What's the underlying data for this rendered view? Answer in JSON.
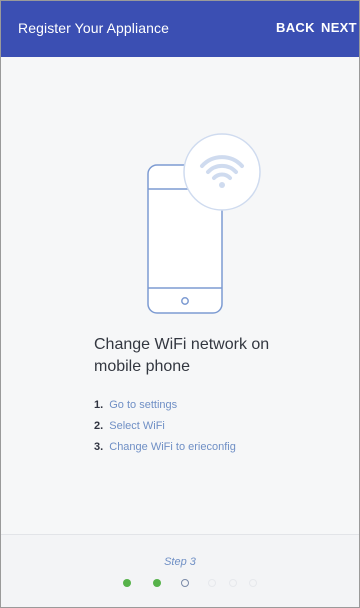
{
  "appbar": {
    "title": "Register Your Appliance",
    "back_label": "BACK",
    "next_label": "NEXT",
    "color": "#3b4fb3"
  },
  "illustration": {
    "icons": [
      "phone-icon",
      "wifi-icon"
    ]
  },
  "content": {
    "heading": "Change WiFi network on mobile phone",
    "steps": [
      {
        "number": "1.",
        "text": "Go to settings"
      },
      {
        "number": "2.",
        "text": "Select WiFi"
      },
      {
        "number": "3.",
        "text": "Change WiFi to erieconfig"
      }
    ]
  },
  "footer": {
    "step_label": "Step 3",
    "progress": {
      "current": 3,
      "total": 6
    },
    "colors": {
      "done": "#56b24a",
      "current": "#7a8aa8",
      "todo": "#e6e8ec"
    }
  }
}
